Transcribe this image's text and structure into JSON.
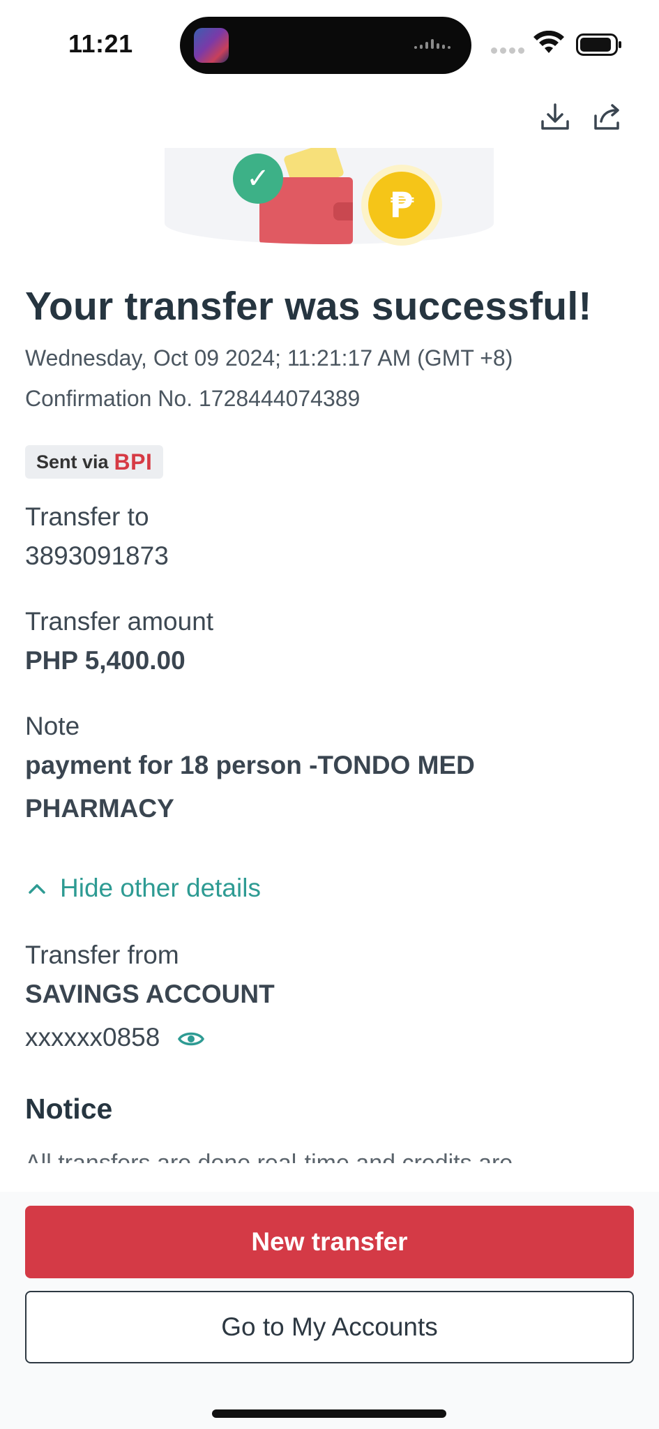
{
  "status_bar": {
    "time": "11:21"
  },
  "header": {
    "download_icon": "download-icon",
    "share_icon": "share-icon"
  },
  "hero": {
    "check_icon": "check-icon",
    "coin_symbol": "₱"
  },
  "receipt": {
    "title": "Your transfer was successful!",
    "datetime": "Wednesday, Oct 09 2024; 11:21:17 AM (GMT +8)",
    "confirmation": "Confirmation No. 1728444074389",
    "sent_via_label": "Sent via",
    "sent_via_bank": "BPI",
    "transfer_to_label": "Transfer to",
    "transfer_to_value": "3893091873",
    "amount_label": "Transfer amount",
    "amount_value": "PHP 5,400.00",
    "note_label": "Note",
    "note_value": "payment for 18 person -TONDO MED PHARMACY",
    "toggle_label": "Hide other details",
    "transfer_from_label": "Transfer from",
    "transfer_from_account": "SAVINGS ACCOUNT",
    "transfer_from_number": "xxxxxx0858",
    "notice_title": "Notice",
    "notice_text": "All transfers are done real-time and credits are"
  },
  "actions": {
    "primary": "New transfer",
    "secondary": "Go to My Accounts"
  },
  "colors": {
    "primary_red": "#d43a46",
    "teal_link": "#2e9b93",
    "success_green": "#3db187",
    "coin_yellow": "#f5c518"
  }
}
